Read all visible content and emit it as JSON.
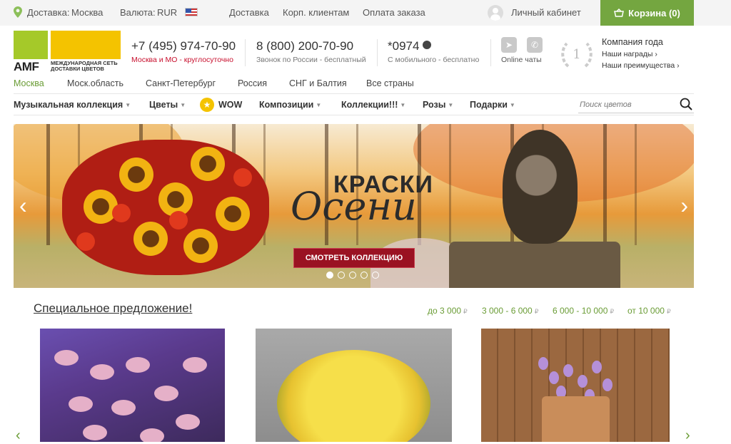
{
  "topbar": {
    "delivery_label": "Доставка:",
    "city": "Москва",
    "currency_label": "Валюта:",
    "currency": "RUR",
    "links": [
      "Доставка",
      "Корп. клиентам",
      "Оплата заказа"
    ],
    "account": "Личный кабинет",
    "cart": "Корзина (0)"
  },
  "logo": {
    "brand": "AMF",
    "tagline": "МЕЖДУНАРОДНАЯ СЕТЬ ДОСТАВКИ ЦВЕТОВ"
  },
  "phones": [
    {
      "number": "+7 (495) 974-70-90",
      "note": "Москва и МО - круглосуточно"
    },
    {
      "number": "8 (800) 200-70-90",
      "note": "Звонок по России - бесплатный"
    },
    {
      "number": "*0974",
      "note": "С мобильного - бесплатно"
    }
  ],
  "chats": {
    "label": "Online чаты"
  },
  "award": {
    "rank": "1",
    "title": "Компания года",
    "link1": "Наши награды ›",
    "link2": "Наши преимущества ›"
  },
  "cities": [
    "Москва",
    "Моск.область",
    "Санкт-Петербург",
    "Россия",
    "СНГ и Балтия",
    "Все страны"
  ],
  "nav": [
    "Музыкальная коллекция",
    "Цветы",
    "WOW",
    "Композиции",
    "Коллекции!!!",
    "Розы",
    "Подарки"
  ],
  "search": {
    "placeholder": "Поиск цветов"
  },
  "banner": {
    "title1": "КРАСКИ",
    "title2": "Осени",
    "button": "СМОТРЕТЬ КОЛЛЕКЦИЮ",
    "slides": 5,
    "active_slide": 1
  },
  "special": {
    "title": "Специальное предложение!",
    "price_filters": [
      "до 3 000",
      "3 000 - 6 000",
      "6 000 - 10 000",
      "от 10 000"
    ],
    "currency_sign": "₽"
  },
  "colors": {
    "accent": "#74a640",
    "red": "#c8102e",
    "logo_green": "#a5c929",
    "logo_yellow": "#f4c300"
  }
}
